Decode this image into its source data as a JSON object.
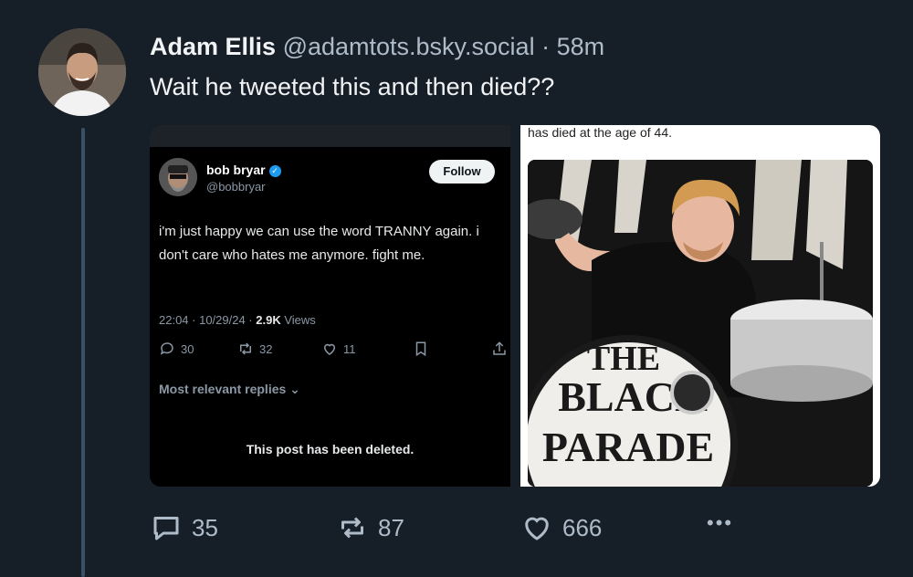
{
  "post": {
    "author_name": "Adam Ellis",
    "author_handle": "@adamtots.bsky.social",
    "separator": "·",
    "time_ago": "58m",
    "text": "Wait he tweeted this and then died??"
  },
  "embed_left": {
    "name": "bob bryar",
    "handle": "@bobbryar",
    "follow_label": "Follow",
    "text": "i'm just happy we can use the word TRANNY again. i don't care who hates me anymore. fight me.",
    "meta_time": "22:04 · 10/29/24 ·",
    "meta_views_count": "2.9K",
    "meta_views_label": "Views",
    "replies": "30",
    "reposts": "32",
    "likes": "11",
    "most_relevant": "Most relevant replies",
    "deleted_notice": "This post has been deleted."
  },
  "embed_right": {
    "caption": "has died at the age of 44.",
    "drum_text": [
      "THE",
      "BLACK",
      "PARADE"
    ]
  },
  "actions": {
    "replies": "35",
    "reposts": "87",
    "likes": "666",
    "more": "•••"
  },
  "colors": {
    "background": "#161e27",
    "thread_line": "#3a5066",
    "muted_text": "#aebbc9",
    "verified_blue": "#1d9bf0"
  }
}
